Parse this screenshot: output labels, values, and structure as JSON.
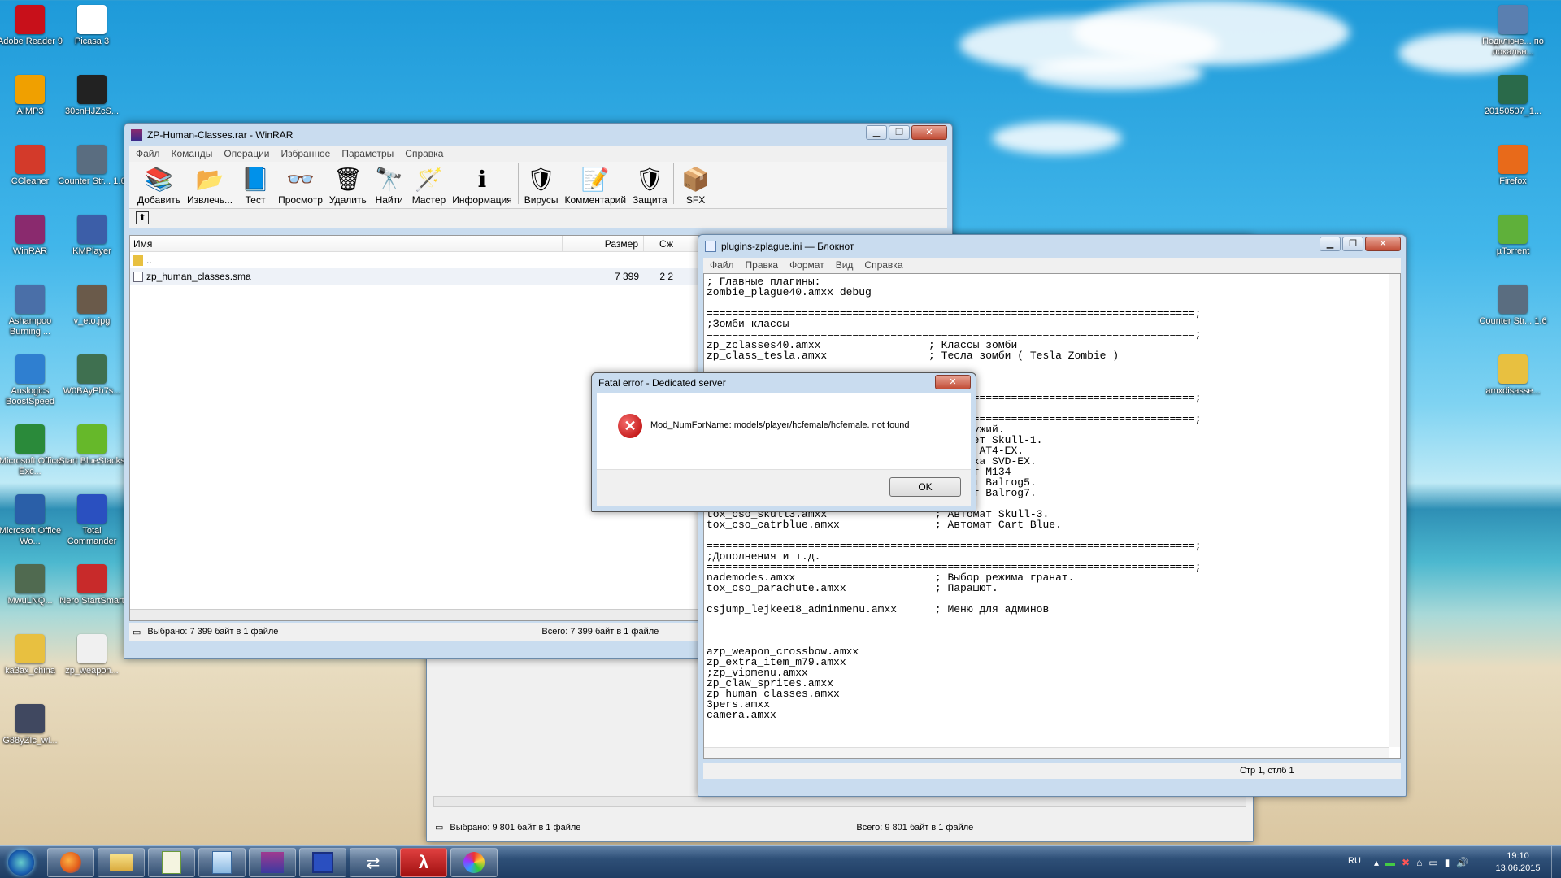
{
  "desktop_left": [
    {
      "label": "Adobe Reader 9",
      "color": "#c8101a"
    },
    {
      "label": "Picasa 3",
      "color": "#ffffff"
    },
    {
      "label": "AIMP3",
      "color": "#f0a000"
    },
    {
      "label": "30cnHJZcS...",
      "color": "#222222"
    },
    {
      "label": "CCleaner",
      "color": "#d33a2a"
    },
    {
      "label": "Counter Str... 1.6",
      "color": "#5a6d80"
    },
    {
      "label": "WinRAR",
      "color": "#8a2a6e"
    },
    {
      "label": "KMPlayer",
      "color": "#3c5ea8"
    },
    {
      "label": "Ashampoo Burning ...",
      "color": "#4a6fa8"
    },
    {
      "label": "v_eto.jpg",
      "color": "#6a5a4a"
    },
    {
      "label": "Auslogics BoostSpeed",
      "color": "#2f7fd0"
    },
    {
      "label": "W0BAyPh7s...",
      "color": "#3f7050"
    },
    {
      "label": "Microsoft Office Exc...",
      "color": "#2a8a3a"
    },
    {
      "label": "Start BlueStacks",
      "color": "#66b82a"
    },
    {
      "label": "Microsoft Office Wo...",
      "color": "#2a5fa8"
    },
    {
      "label": "Total Commander",
      "color": "#2a50c0"
    },
    {
      "label": "MwuLNQ...",
      "color": "#506a50"
    },
    {
      "label": "Nero StartSmart",
      "color": "#c82a2a"
    },
    {
      "label": "ka3ax_china",
      "color": "#e8c040"
    },
    {
      "label": "zp_weapon...",
      "color": "#f0f0f0"
    },
    {
      "label": "G88yZIc_wl...",
      "color": "#404860"
    }
  ],
  "desktop_right": [
    {
      "label": "Подключе... по локальн...",
      "color": "#5a7fb0"
    },
    {
      "label": "20150507_1...",
      "color": "#2a6a4a"
    },
    {
      "label": "Firefox",
      "color": "#e86a1a"
    },
    {
      "label": "µTorrent",
      "color": "#5fb03a"
    },
    {
      "label": "Counter Str... 1.6",
      "color": "#5a6d80"
    },
    {
      "label": "amxdisasse...",
      "color": "#e8c040"
    }
  ],
  "winrar": {
    "title": "ZP-Human-Classes.rar - WinRAR",
    "menu": [
      "Файл",
      "Команды",
      "Операции",
      "Избранное",
      "Параметры",
      "Справка"
    ],
    "toolbar": [
      {
        "label": "Добавить",
        "icon": "add-icon",
        "glyph": "📚"
      },
      {
        "label": "Извлечь...",
        "icon": "extract-icon",
        "glyph": "📂"
      },
      {
        "label": "Тест",
        "icon": "test-icon",
        "glyph": "📘"
      },
      {
        "label": "Просмотр",
        "icon": "view-icon",
        "glyph": "👓"
      },
      {
        "label": "Удалить",
        "icon": "delete-icon",
        "glyph": "🗑"
      },
      {
        "label": "Найти",
        "icon": "find-icon",
        "glyph": "🔭"
      },
      {
        "label": "Мастер",
        "icon": "wizard-icon",
        "glyph": "🪄"
      },
      {
        "label": "Информация",
        "icon": "info-icon",
        "glyph": "ℹ"
      },
      {
        "label": "Вирусы",
        "icon": "virus-icon",
        "glyph": "🛡"
      },
      {
        "label": "Комментарий",
        "icon": "comment-icon",
        "glyph": "📝"
      },
      {
        "label": "Защита",
        "icon": "protect-icon",
        "glyph": "🛡"
      },
      {
        "label": "SFX",
        "icon": "sfx-icon",
        "glyph": "📦"
      }
    ],
    "columns": {
      "name": "Имя",
      "size": "Размер",
      "packed": "Сж"
    },
    "rows": [
      {
        "name": "..",
        "size": "",
        "packed": ""
      },
      {
        "name": "zp_human_classes.sma",
        "size": "7 399",
        "packed": "2 2"
      }
    ],
    "status_left": "Выбрано: 7 399 байт в 1 файле",
    "status_right": "Всего: 7 399 байт в 1 файле"
  },
  "winrar_back": {
    "status_left": "Выбрано: 9 801 байт в 1 файле",
    "status_right": "Всего: 9 801 байт в 1 файле"
  },
  "notepad": {
    "title": "plugins-zplague.ini — Блокнот",
    "menu": [
      "Файл",
      "Правка",
      "Формат",
      "Вид",
      "Справка"
    ],
    "text": "; Главные плагины:\nzombie_plague40.amxx debug\n\n=============================================================================;\n;Зомби классы\n=============================================================================;\nzp_zclasses40.amxx                 ; Классы зомби\nzp_class_tesla.amxx                ; Тесла зомби ( Tesla Zombie )\n\n\n\n=============================================================================;\n\n=============================================================================;\n                                    Так оружий.\n                                    Пистолет Skull-1.\n                                    Базука AT4-EX.\n                                    Винтовка SVD-EX.\n                                    Пулемет M134\n                                    Автомат Balrog5.\n                                    Автомат Balrog7.\n\ntox_cso_skull3.amxx                 ; Автомат Skull-3.\ntox_cso_catrblue.amxx               ; Автомат Cart Blue.\n\n=============================================================================;\n;Дополнения и т.д.\n=============================================================================;\nnademodes.amxx                      ; Выбор режима гранат.\ntox_cso_parachute.amxx              ; Парашют.\n\ncsjump_lejkee18_adminmenu.amxx      ; Меню для админов\n\n\n\nazp_weapon_crossbow.amxx\nzp_extra_item_m79.amxx\n;zp_vipmenu.amxx\nzp_claw_sprites.amxx\nzp_human_classes.amxx\n3pers.amxx\ncamera.amxx",
    "status": "Стр 1, стлб 1"
  },
  "dialog": {
    "title": "Fatal error - Dedicated server",
    "message": "Mod_NumForName: models/player/hcfemale/hcfemale. not found",
    "ok": "OK"
  },
  "taskbar": {
    "lang": "RU",
    "time": "19:10",
    "date": "13.06.2015"
  }
}
